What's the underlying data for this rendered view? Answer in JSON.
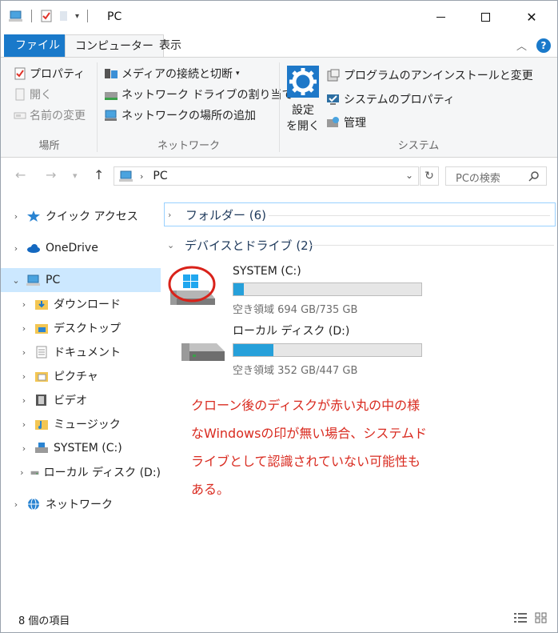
{
  "window": {
    "title": "PC",
    "controls": {
      "minimize": "—",
      "maximize": "☐",
      "close": "✕"
    }
  },
  "ribbon_tabs": [
    {
      "label": "ファイル"
    },
    {
      "label": "コンピューター"
    },
    {
      "label": "表示"
    }
  ],
  "ribbon": {
    "location": {
      "label": "場所",
      "items": [
        "プロパティ",
        "開く",
        "名前の変更"
      ]
    },
    "network": {
      "label": "ネットワーク",
      "items": [
        "メディアの接続と切断",
        "ネットワーク ドライブの割り当て",
        "ネットワークの場所の追加"
      ]
    },
    "system": {
      "label": "システム",
      "settings_line1": "設定",
      "settings_line2": "を開く",
      "items": [
        "プログラムのアンインストールと変更",
        "システムのプロパティ",
        "管理"
      ]
    }
  },
  "address": {
    "crumb": "PC",
    "search_placeholder": "PCの検索"
  },
  "nav": [
    {
      "label": "クイック アクセス",
      "icon": "star-icon"
    },
    {
      "label": "OneDrive",
      "icon": "cloud-icon"
    },
    {
      "label": "PC",
      "icon": "pc-icon"
    },
    {
      "label": "ダウンロード",
      "icon": "download-folder-icon"
    },
    {
      "label": "デスクトップ",
      "icon": "desktop-folder-icon"
    },
    {
      "label": "ドキュメント",
      "icon": "documents-icon"
    },
    {
      "label": "ピクチャ",
      "icon": "pictures-icon"
    },
    {
      "label": "ビデオ",
      "icon": "videos-icon"
    },
    {
      "label": "ミュージック",
      "icon": "music-icon"
    },
    {
      "label": "SYSTEM (C:)",
      "icon": "system-drive-icon"
    },
    {
      "label": "ローカル ディスク (D:)",
      "icon": "drive-icon"
    },
    {
      "label": "ネットワーク",
      "icon": "network-icon"
    }
  ],
  "content": {
    "folders_header": "フォルダー (6)",
    "devices_header": "デバイスとドライブ (2)",
    "drives": [
      {
        "name": "SYSTEM (C:)",
        "free_text": "空き領域 694 GB/735 GB",
        "used_fraction": 0.056
      },
      {
        "name": "ローカル ディスク (D:)",
        "free_text": "空き領域 352 GB/447 GB",
        "used_fraction": 0.213
      }
    ]
  },
  "annotation": {
    "lines": [
      "クローン後のディスクが赤い丸の中の様",
      "なWindowsの印が無い場合、システムド",
      "ライブとして認識されていない可能性も",
      "ある。"
    ],
    "color": "#d92b20"
  },
  "status": {
    "count": "8 個の項目"
  },
  "colors": {
    "accent": "#1979ca",
    "selection": "#cce8ff",
    "bar_fill": "#26a0da"
  }
}
